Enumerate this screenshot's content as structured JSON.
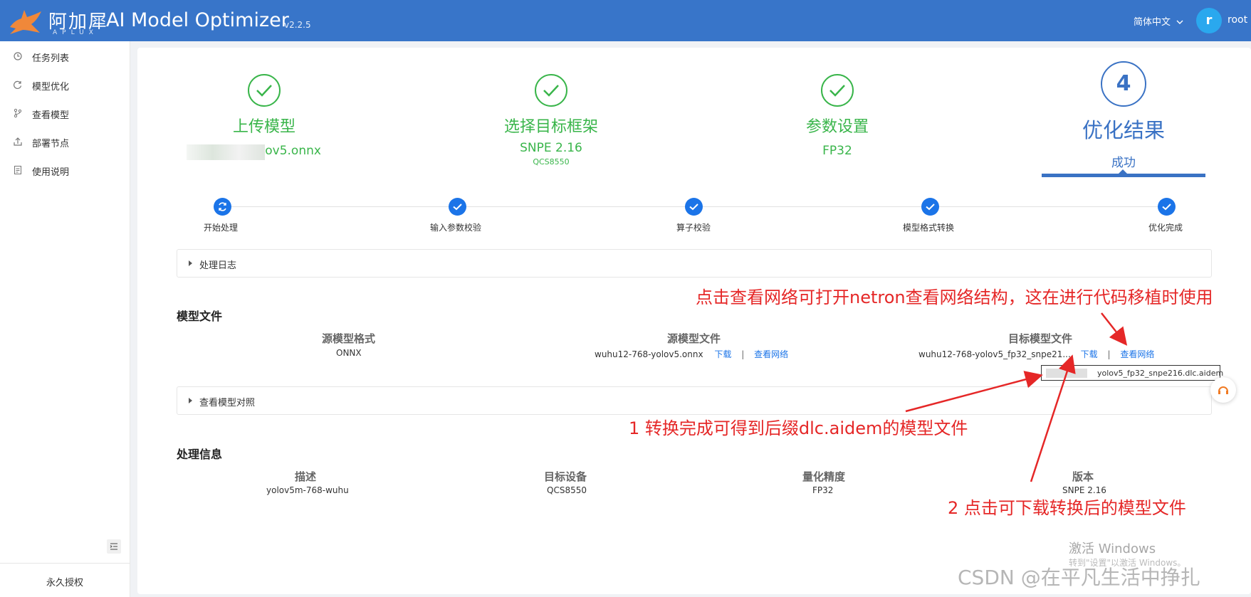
{
  "header": {
    "brand_cn": "阿加犀",
    "brand_en": "APLUX",
    "title": "AI Model Optimizer",
    "version": "v2.2.5",
    "language": "简体中文",
    "avatar_letter": "r",
    "user": "root",
    "bg_color": "#3875c9"
  },
  "sidebar": {
    "items": [
      {
        "label": "任务列表",
        "icon": "history-icon"
      },
      {
        "label": "模型优化",
        "icon": "refresh-icon"
      },
      {
        "label": "查看模型",
        "icon": "branch-icon"
      },
      {
        "label": "部署节点",
        "icon": "upload-icon"
      },
      {
        "label": "使用说明",
        "icon": "document-icon"
      }
    ],
    "footer": "永久授权"
  },
  "steps": [
    {
      "title": "上传模型",
      "sub": "yolov5.onnx",
      "status": "done"
    },
    {
      "title": "选择目标框架",
      "sub": "SNPE 2.16",
      "sub2": "QCS8550",
      "status": "done"
    },
    {
      "title": "参数设置",
      "sub": "FP32",
      "status": "done"
    },
    {
      "number": "4",
      "title": "优化结果",
      "sub": "成功",
      "status": "current"
    }
  ],
  "progress": [
    {
      "label": "开始处理"
    },
    {
      "label": "输入参数校验"
    },
    {
      "label": "算子校验"
    },
    {
      "label": "模型格式转换"
    },
    {
      "label": "优化完成"
    }
  ],
  "log_panel": {
    "label": "处理日志"
  },
  "model_files": {
    "title": "模型文件",
    "source_format_label": "源模型格式",
    "source_format": "ONNX",
    "source_file_label": "源模型文件",
    "source_file": "wuhu12-768-yolov5.onnx",
    "target_file_label": "目标模型文件",
    "target_file": "wuhu12-768-yolov5_fp32_snpe21...",
    "download": "下载",
    "view_network": "查看网络",
    "separator": "|",
    "tooltip": "yolov5_fp32_snpe216.dlc.aidem"
  },
  "compare_panel": {
    "label": "查看模型对照"
  },
  "process_info": {
    "title": "处理信息",
    "desc_label": "描述",
    "desc": "yolov5m-768-wuhu",
    "device_label": "目标设备",
    "device": "QCS8550",
    "precision_label": "量化精度",
    "precision": "FP32",
    "version_label": "版本",
    "version": "SNPE 2.16"
  },
  "annotations": {
    "a1": "点击查看网络可打开netron查看网络结构，这在进行代码移植时使用",
    "a2": "1 转换完成可得到后缀dlc.aidem的模型文件",
    "a3": "2 点击可下载转换后的模型文件"
  },
  "watermark": {
    "activate": "激活 Windows",
    "activate_sub": "转到\"设置\"以激活 Windows。",
    "csdn": "CSDN @在平凡生活中挣扎"
  }
}
